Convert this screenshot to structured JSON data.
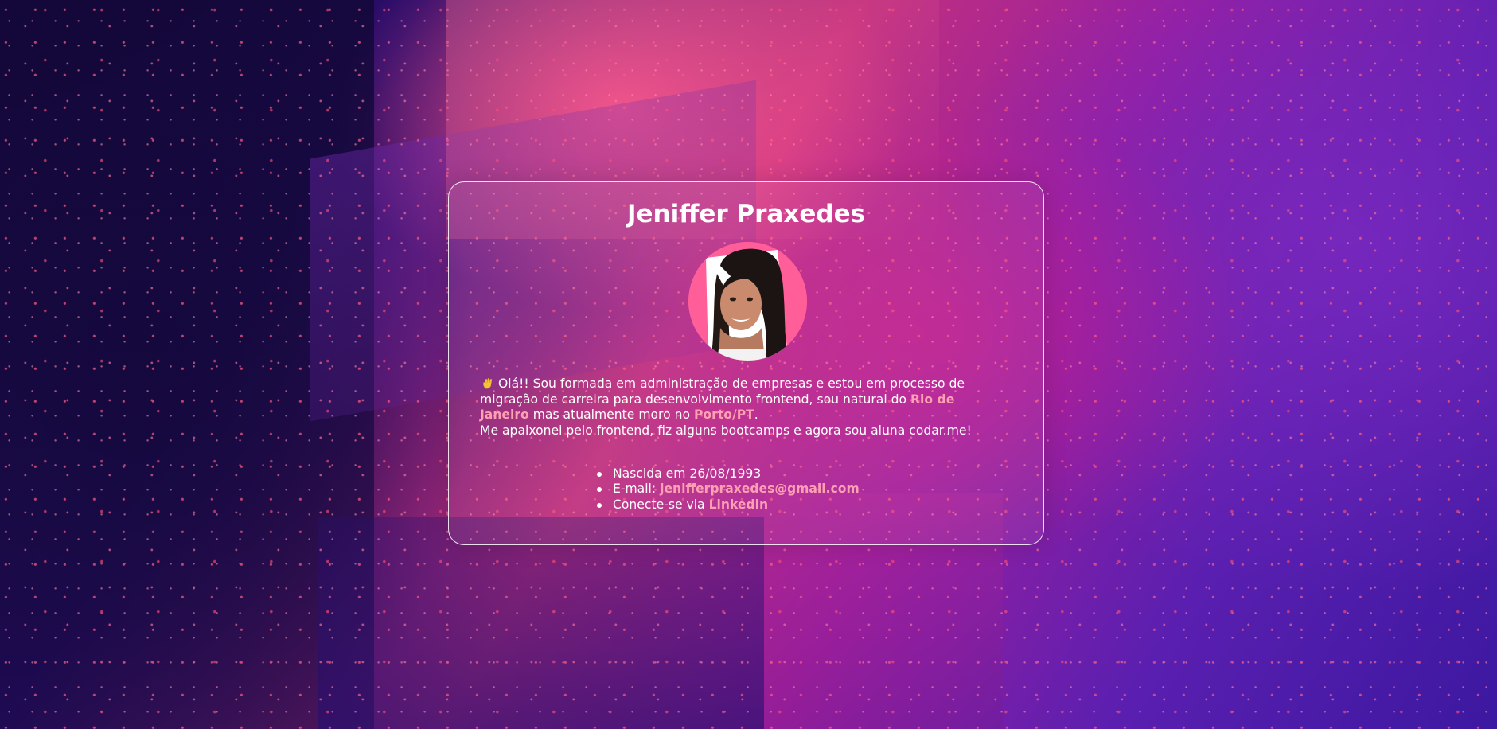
{
  "colors": {
    "accent_link": "#ff9fb3",
    "text": "#ffffff",
    "avatar_bg": "#ff5e98",
    "card_border": "#ffffff"
  },
  "card": {
    "title": "Jeniffer Praxedes",
    "avatar_alt": "foto de perfil",
    "bio": {
      "wave_icon": "waving-hand-icon",
      "part1": "Olá!! Sou formada em administração de empresas e estou em processo de migração de carreira para desenvolvimento frontend, sou natural do ",
      "place1": "Rio de Janeiro",
      "part2": " mas atualmente moro no ",
      "place2": "Porto/PT",
      "part3": ".",
      "line2": " Me apaixonei pelo frontend, fiz alguns bootcamps e agora sou aluna codar.me!"
    },
    "info": {
      "birth": "Nascida em 26/08/1993",
      "email_label": "E-mail: ",
      "email_link": "jenifferpraxedes@gmail.com",
      "linkedin_label": "Conecte-se via ",
      "linkedin_link": "Linkedin"
    }
  }
}
